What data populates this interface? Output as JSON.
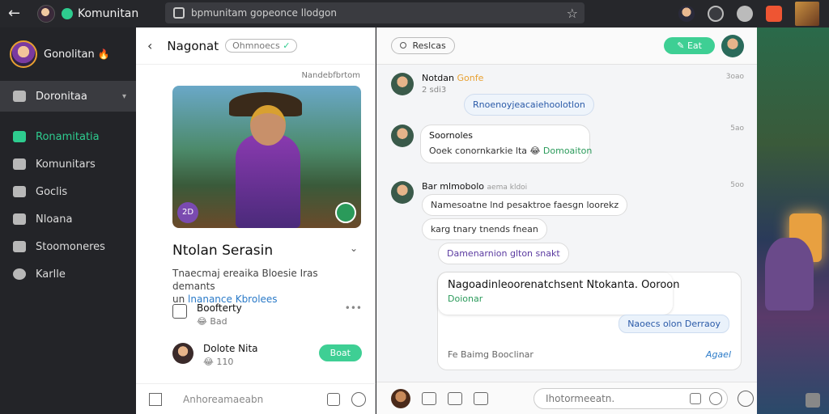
{
  "topbar": {
    "app_name": "Komunitan",
    "url": "bpmunitam gopeonce llodgon",
    "back_glyph": "←",
    "star_glyph": "☆"
  },
  "sidebar": {
    "title": "Gonolitan",
    "title_emoji": "🔥",
    "selected": "Doronitaa",
    "items": [
      {
        "label": "Ronamitatia",
        "active": true
      },
      {
        "label": "Komunitars",
        "active": false
      },
      {
        "label": "Goclis",
        "active": false
      },
      {
        "label": "Nloana",
        "active": false
      },
      {
        "label": "Stoomoneres",
        "active": false
      },
      {
        "label": "Karlle",
        "active": false
      }
    ]
  },
  "profile": {
    "name": "Nagonat",
    "status_pill": "Ohmnoecs",
    "caption": "Nandebfbrtom",
    "character_name": "Ntolan Serasin",
    "description_line1": "Tnaecmaj ereaika Bloesie Iras demants",
    "description_line2_prefix": "un",
    "description_link": "lnanance Kbrolees",
    "rows": [
      {
        "title": "Boofterty",
        "sub": "😂 Bad"
      },
      {
        "title": "Dolote Nita",
        "sub": "😂 110",
        "button": "Boat"
      }
    ],
    "hero_badge": "2D",
    "footer_placeholder": "Anhoreamaeabn"
  },
  "chat": {
    "tag": "Reslcas",
    "header_button": "Eat",
    "messages": [
      {
        "author": "Notdan",
        "author_extra": "Gonfe",
        "sub": "2 sdi3",
        "time": "3oao",
        "bubble": "Rnoenoyjeacaiehoolotlon"
      },
      {
        "author": "Soornoles",
        "time": "5ao",
        "bubble_a": "Ooek conornkarkie lta",
        "bubble_a_green": "Domoaiton"
      },
      {
        "author": "Bar mlmobolo",
        "author_sub": "aema kldoi",
        "time": "5oo",
        "bubble_a": "Namesoatne lnd pesaktroe faesgn loorekz",
        "bubble_b": "karg tnary tnends fnean",
        "bubble_c": "Damenarnion glton snakt"
      },
      {
        "card_title": "Nagoadinleoorenatchsent Ntokanta. Ooroon",
        "card_sub": "Doionar",
        "chip": "Naoecs olon Derraoy",
        "foot_left": "Fe Baimg Booclinar",
        "foot_right": "Agael"
      }
    ],
    "input_placeholder": "Ihotormeeatn."
  }
}
